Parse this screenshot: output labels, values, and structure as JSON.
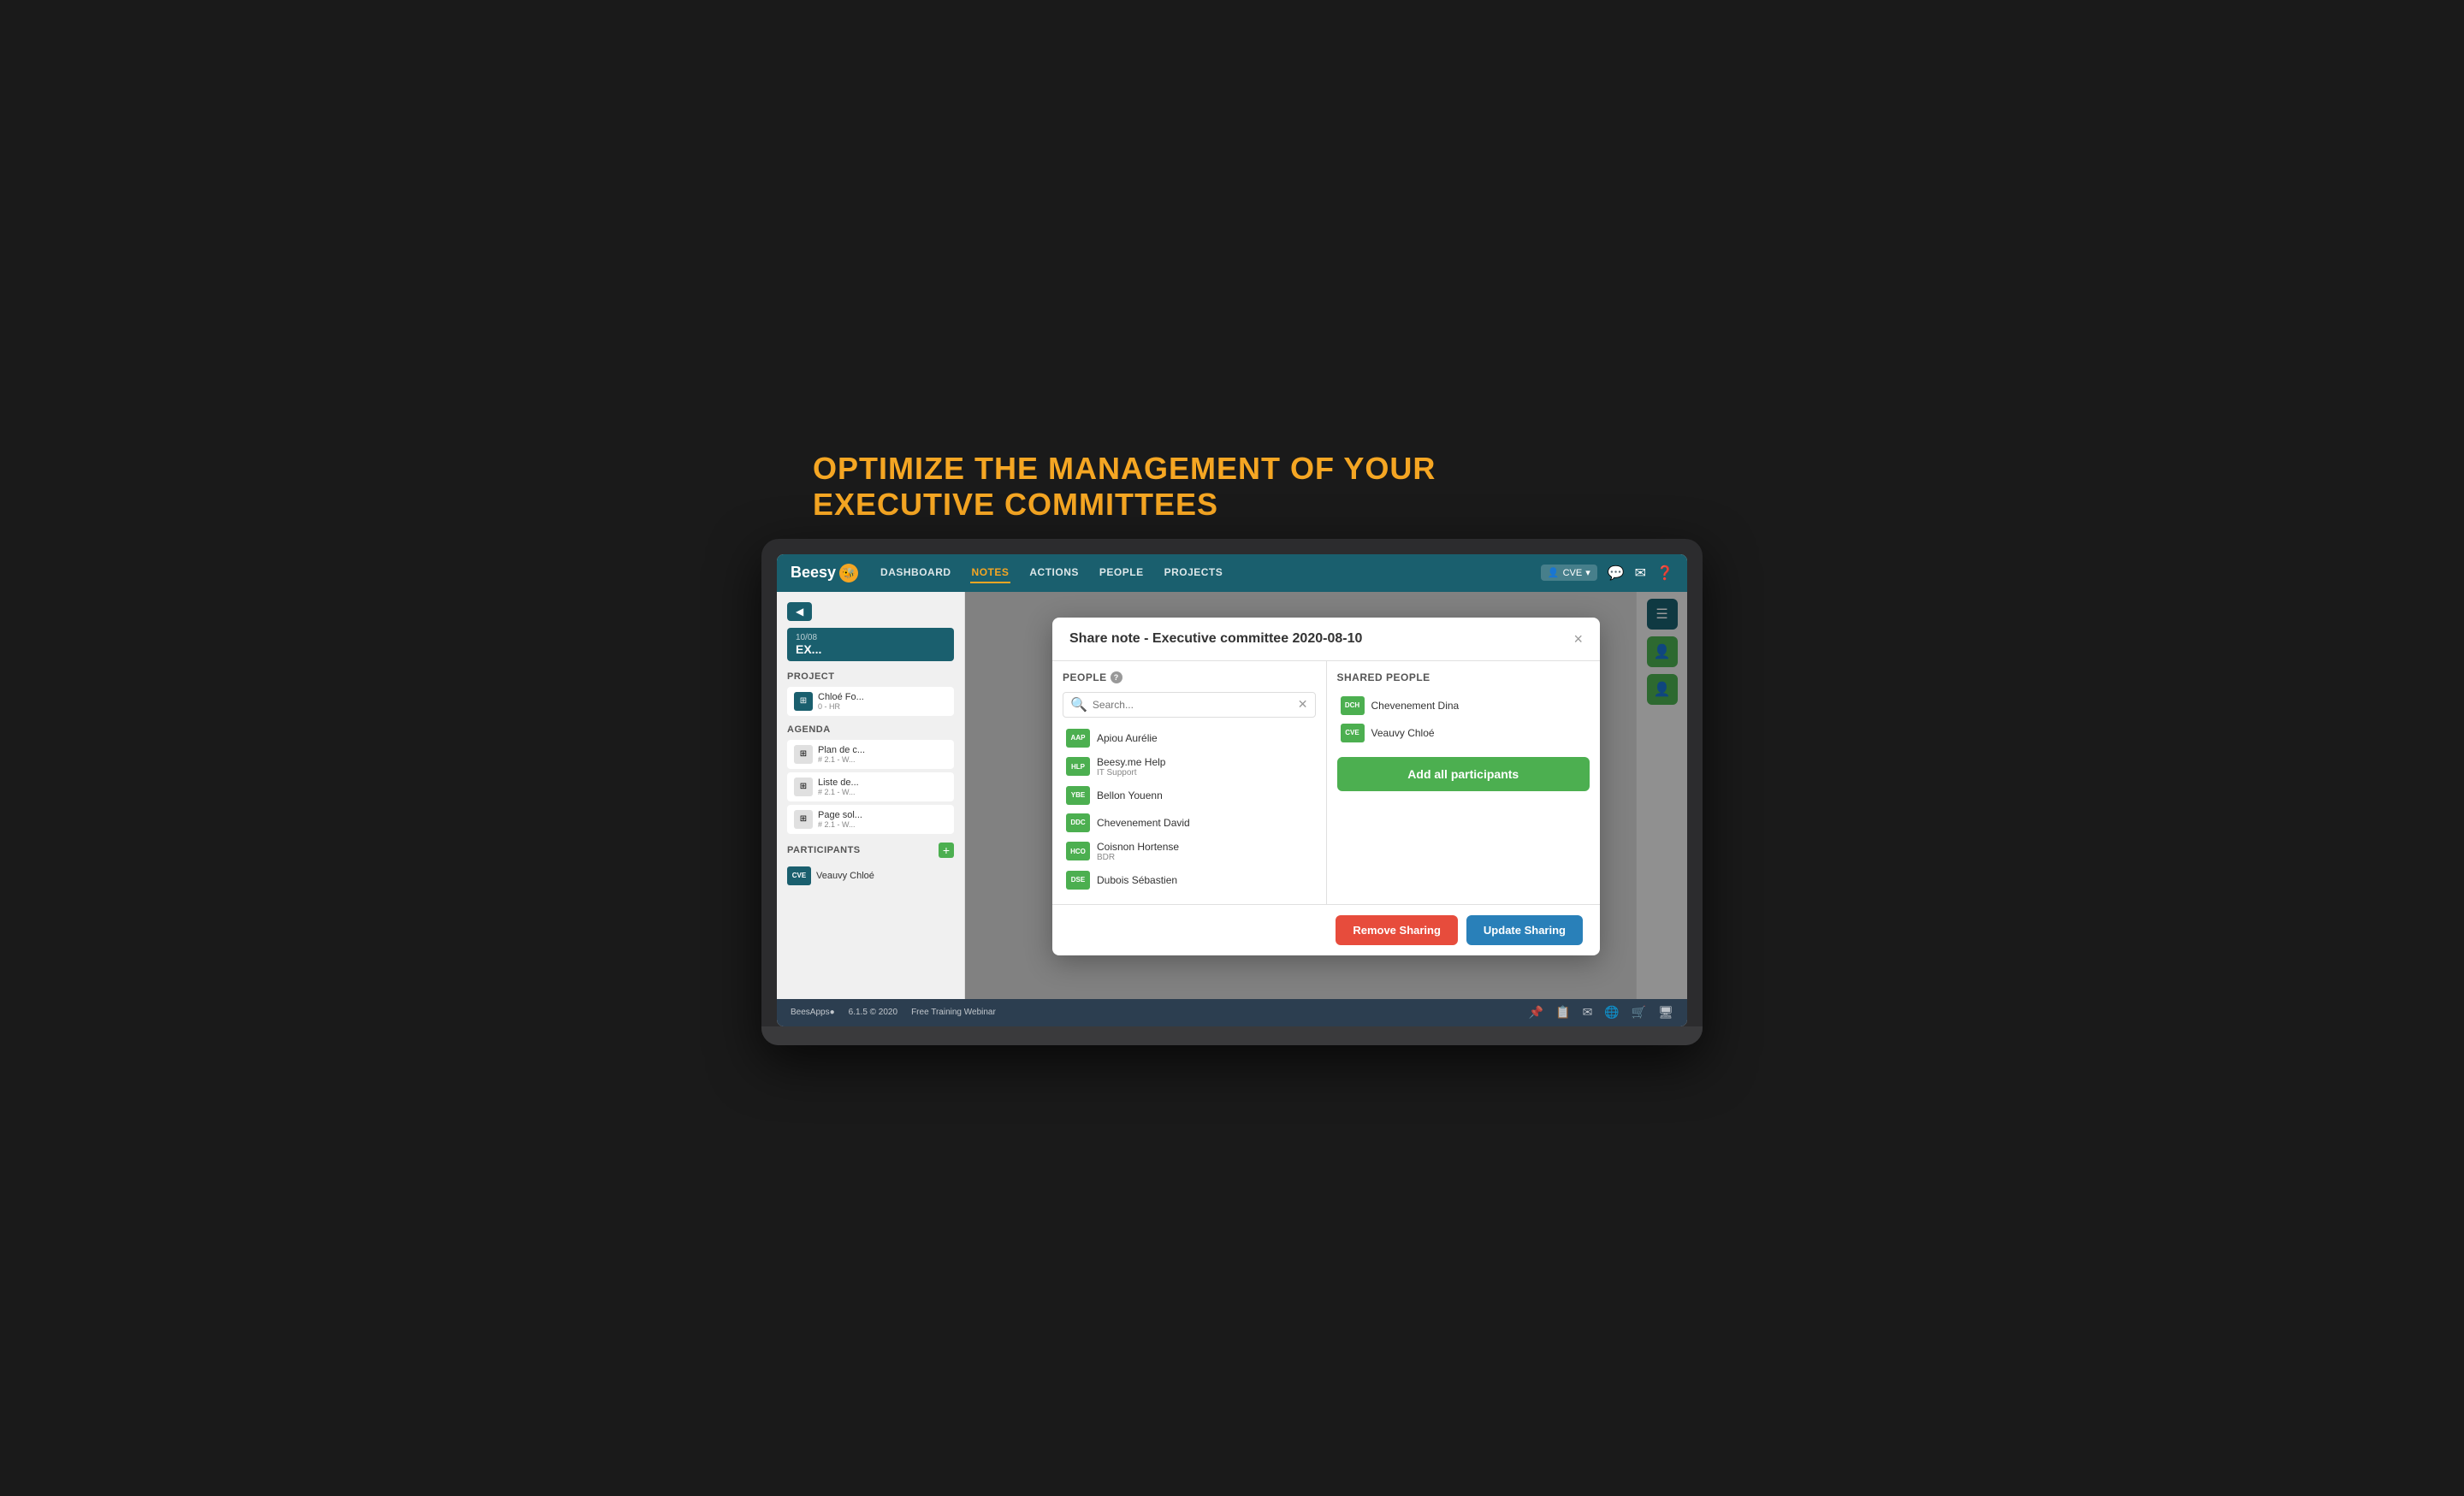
{
  "headline": {
    "line1": "OPTIMIZE THE MANAGEMENT OF YOUR",
    "line2": "EXECUTIVE COMMITTEES"
  },
  "navbar": {
    "logo": "Beesy",
    "links": [
      {
        "label": "DASHBOARD",
        "active": false
      },
      {
        "label": "NOTES",
        "active": true
      },
      {
        "label": "ACTIONS",
        "active": false
      },
      {
        "label": "PEOPLE",
        "active": false
      },
      {
        "label": "PROJECTS",
        "active": false
      }
    ],
    "user": "CVE",
    "user_icon": "👤"
  },
  "sidebar": {
    "date": "10/08",
    "page_title": "EX...",
    "sections": {
      "project_label": "PROJECT",
      "project_items": [
        {
          "icon": "⊞",
          "name": "Chloé Fo...",
          "detail": "0 - HR"
        }
      ],
      "agenda_label": "AGENDA",
      "agenda_items": [
        {
          "icon": "⊞",
          "name": "Plan de c...",
          "detail": "# 2.1 - W..."
        },
        {
          "icon": "⊞",
          "name": "Liste de...",
          "detail": "# 2.1 - W..."
        },
        {
          "icon": "⊞",
          "name": "Page sol...",
          "detail": "# 2.1 - W..."
        }
      ],
      "participants_label": "PARTICIPANTS",
      "participants": [
        {
          "badge": "CVE",
          "name": "Veauvy Chloé"
        }
      ]
    }
  },
  "modal": {
    "title": "Share note - Executive committee 2020-08-10",
    "close_label": "×",
    "left_col_header": "PEOPLE",
    "search_placeholder": "Search...",
    "people": [
      {
        "initials": "AAP",
        "name": "Apiou Aurélie",
        "role": ""
      },
      {
        "initials": "HLP",
        "name": "Beesy.me Help",
        "role": "IT Support"
      },
      {
        "initials": "YBE",
        "name": "Bellon Youenn",
        "role": ""
      },
      {
        "initials": "DDC",
        "name": "Chevenement David",
        "role": ""
      },
      {
        "initials": "HCO",
        "name": "Coisnon Hortense",
        "role": "BDR"
      },
      {
        "initials": "DSE",
        "name": "Dubois Sébastien",
        "role": ""
      }
    ],
    "right_col_header": "SHARED PEOPLE",
    "shared_people": [
      {
        "initials": "DCH",
        "name": "Chevenement Dina"
      },
      {
        "initials": "CVE",
        "name": "Veauvy Chloé"
      }
    ],
    "add_all_label": "Add all participants",
    "remove_btn": "Remove Sharing",
    "update_btn": "Update Sharing"
  },
  "footer": {
    "logo": "BeesApps●",
    "version": "6.1.5 © 2020",
    "training": "Free Training Webinar"
  }
}
